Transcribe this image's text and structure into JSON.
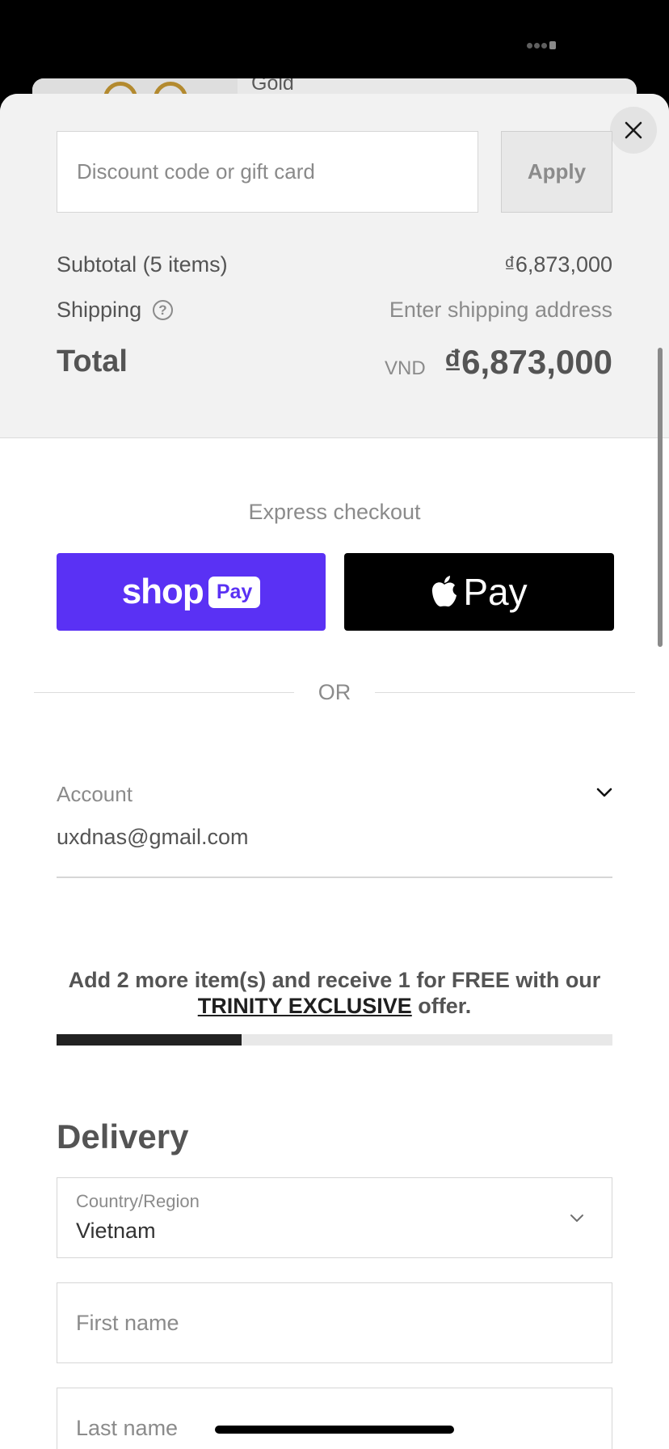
{
  "background_item": {
    "name": "Gold"
  },
  "discount": {
    "placeholder": "Discount code or gift card",
    "apply_label": "Apply"
  },
  "summary": {
    "subtotal_label": "Subtotal (5 items)",
    "subtotal_value": "₫6,873,000",
    "shipping_label": "Shipping",
    "shipping_value": "Enter shipping address",
    "total_label": "Total",
    "currency": "VND",
    "total_value": "₫6,873,000"
  },
  "express": {
    "title": "Express checkout",
    "shop_pay_word": "shop",
    "shop_pay_badge": "Pay",
    "apple_pay_label": "Pay"
  },
  "or_label": "OR",
  "account": {
    "label": "Account",
    "email": "uxdnas@gmail.com"
  },
  "promo": {
    "text_before": "Add 2 more item(s) and receive 1 for FREE with our",
    "link_text": "TRINITY EXCLUSIVE",
    "text_after": " offer.",
    "progress": 0.333
  },
  "delivery": {
    "title": "Delivery",
    "country_label": "Country/Region",
    "country_value": "Vietnam",
    "first_name_placeholder": "First name",
    "last_name_placeholder": "Last name"
  },
  "colors": {
    "shop_pay": "#5a31f4",
    "apple_pay": "#000000",
    "summary_bg": "#f2f2f2",
    "progress_fill": "#222222"
  }
}
